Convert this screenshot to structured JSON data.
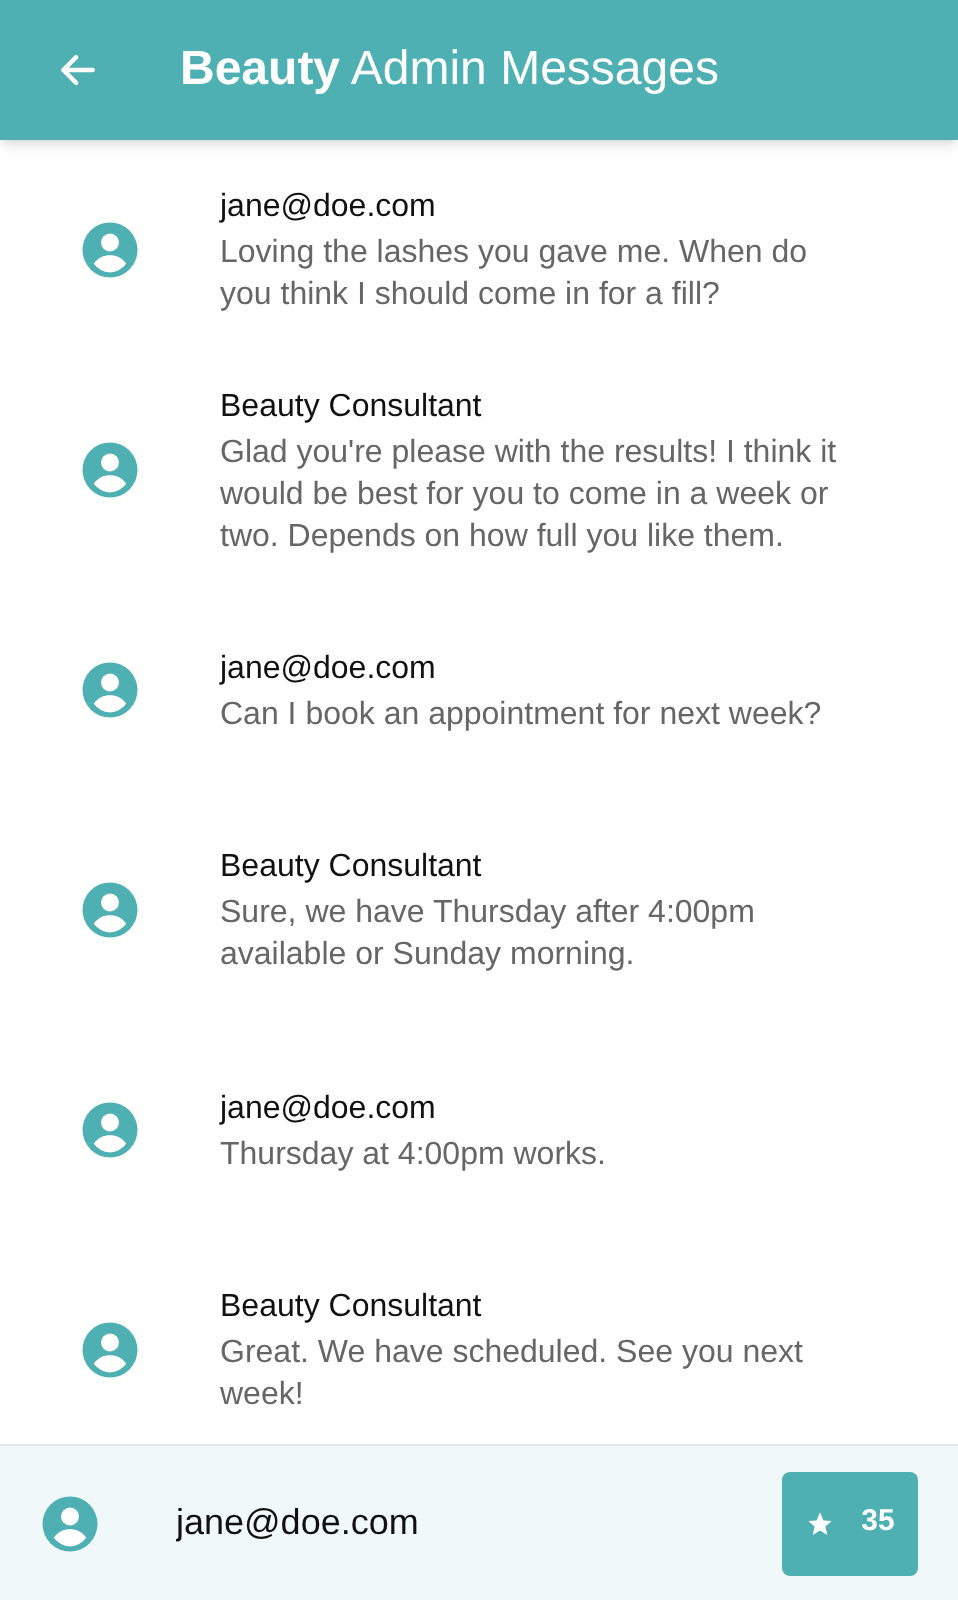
{
  "header": {
    "title": "**Beauty** Admin Messages"
  },
  "messages": [
    {
      "sender": "jane@doe.com",
      "text": "Loving the lashes you gave me. When do you think I should come in for a fill?"
    },
    {
      "sender": "Beauty Consultant",
      "text": "Glad you're please with the results! I think it would be best for you to come in a week or two. Depends on how full you like them."
    },
    {
      "sender": "jane@doe.com",
      "text": "Can I book an appointment for next week?"
    },
    {
      "sender": "Beauty Consultant",
      "text": "Sure, we have Thursday after 4:00pm available or Sunday morning."
    },
    {
      "sender": "jane@doe.com",
      "text": "Thursday at 4:00pm works."
    },
    {
      "sender": "Beauty Consultant",
      "text": "Great. We have scheduled. See you next week!"
    }
  ],
  "composer": {
    "value": "jane@doe.com",
    "button_count": "35"
  }
}
